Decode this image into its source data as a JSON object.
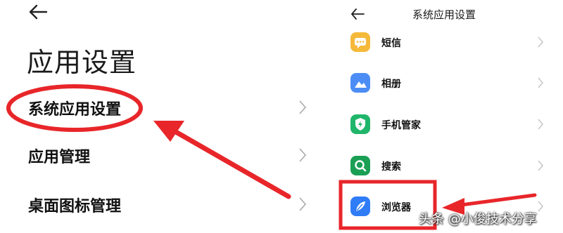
{
  "left": {
    "title": "应用设置",
    "items": [
      {
        "label": "系统应用设置"
      },
      {
        "label": "应用管理"
      },
      {
        "label": "桌面图标管理"
      }
    ]
  },
  "right": {
    "title": "系统应用设置",
    "apps": [
      {
        "label": "短信",
        "icon": "message-icon",
        "color": "#F5B93A"
      },
      {
        "label": "相册",
        "icon": "gallery-icon",
        "color": "#4C8DF5"
      },
      {
        "label": "手机管家",
        "icon": "shield-icon",
        "color": "#1FB56A"
      },
      {
        "label": "搜索",
        "icon": "search-icon",
        "color": "#1A9F55"
      },
      {
        "label": "浏览器",
        "icon": "browser-icon",
        "color": "#2F7CF6"
      }
    ]
  },
  "annotations": {
    "color": "#E8262A"
  },
  "watermark": "头条 @小俊技术分享"
}
